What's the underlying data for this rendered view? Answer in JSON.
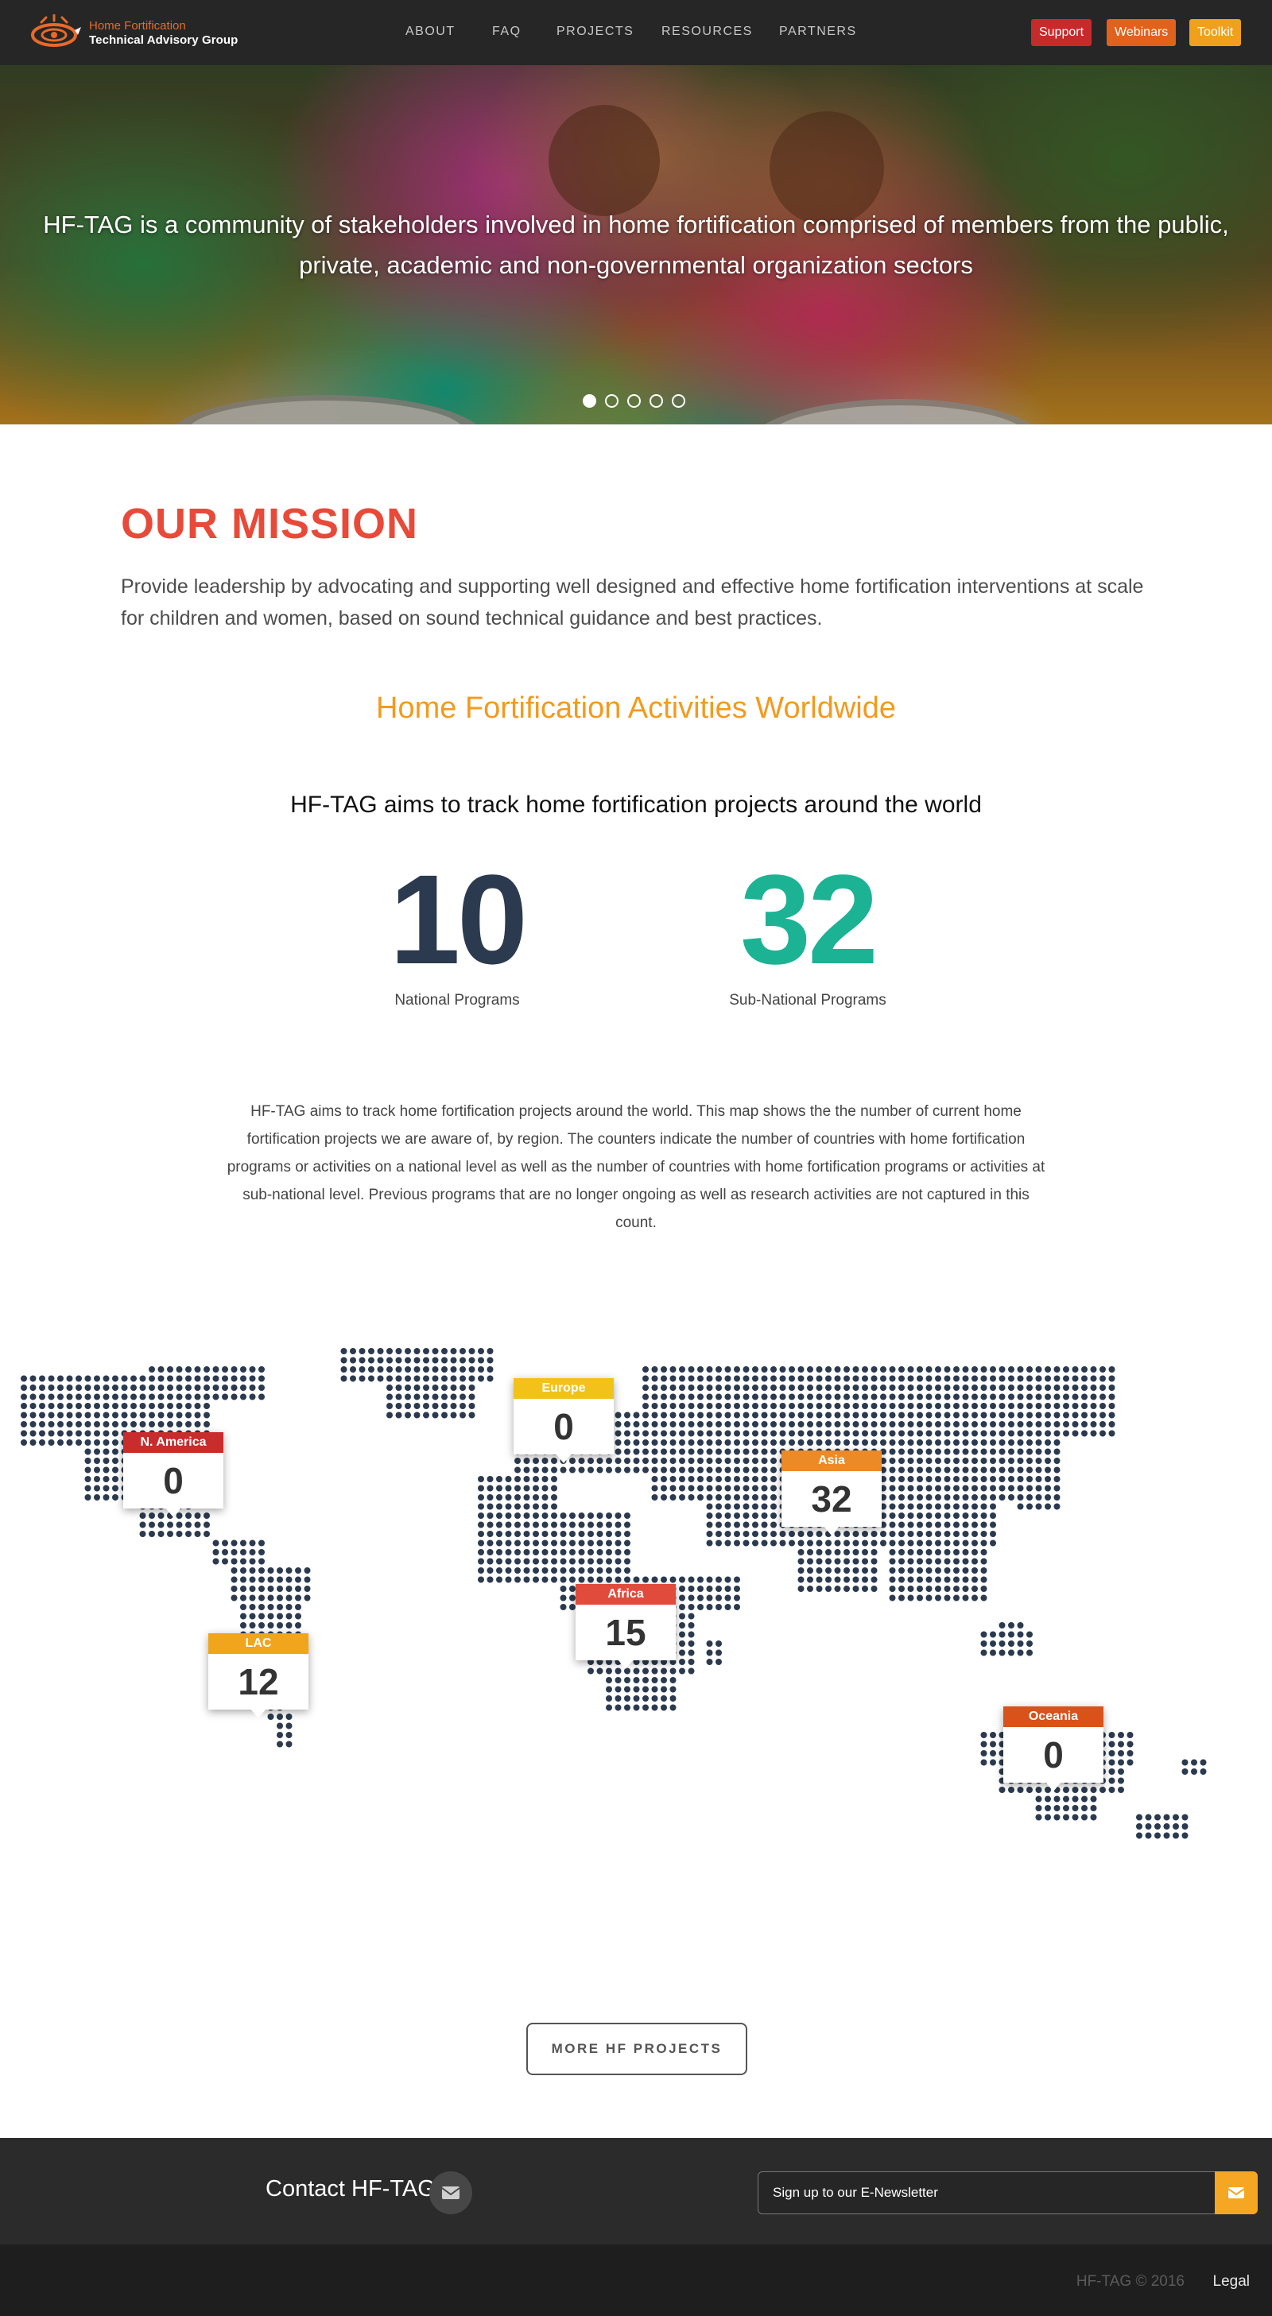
{
  "nav": {
    "logo_line1": "Home Fortification",
    "logo_line2": "Technical Advisory Group",
    "links": [
      "ABOUT",
      "FAQ",
      "PROJECTS",
      "RESOURCES",
      "PARTNERS"
    ],
    "buttons": [
      {
        "label": "Support",
        "color": "#c62b2b"
      },
      {
        "label": "Webinars",
        "color": "#e0621d"
      },
      {
        "label": "Toolkit",
        "color": "#f0a01c"
      }
    ]
  },
  "hero": {
    "text": "HF-TAG is a community of stakeholders involved in home fortification comprised of members from the public, private, academic and non-governmental organization sectors",
    "slide_count": 5,
    "active_slide": 1
  },
  "mission": {
    "title": "OUR MISSION",
    "text": "Provide leadership by advocating and supporting well designed and effective home fortification interventions at scale for children and women, based on sound technical guidance and best practices."
  },
  "activities": {
    "title": "Home Fortification Activities Worldwide",
    "subtitle": "HF-TAG aims to track home fortification projects around the world",
    "counters": [
      {
        "value": "10",
        "label": "National Programs",
        "color": "#2b3a4e"
      },
      {
        "value": "32",
        "label": "Sub-National Programs",
        "color": "#1bb394"
      }
    ],
    "description": "HF-TAG aims to track home fortification projects around the world. This map shows the the number of current home fortification projects we are aware of, by region. The counters indicate the number of countries with home fortification programs or activities on a national level as well as the number of countries with home fortification programs or activities at sub-national level. Previous programs that are no longer ongoing as well as research activities are not captured in this count."
  },
  "map": {
    "regions": [
      {
        "name": "N. America",
        "value": "0",
        "color": "#c92c2c"
      },
      {
        "name": "Europe",
        "value": "0",
        "color": "#f2c21a"
      },
      {
        "name": "Asia",
        "value": "32",
        "color": "#ec8a28"
      },
      {
        "name": "Africa",
        "value": "15",
        "color": "#e04b3c"
      },
      {
        "name": "LAC",
        "value": "12",
        "color": "#f0a51c"
      },
      {
        "name": "Oceania",
        "value": "0",
        "color": "#d9521a"
      }
    ],
    "dot_color": "#2b3a4e"
  },
  "more_button": "MORE HF PROJECTS",
  "footer": {
    "contact": "Contact HF-TAG",
    "newsletter_placeholder": "Sign up to our E-Newsletter",
    "copyright": "HF-TAG © 2016",
    "legal": "Legal"
  }
}
